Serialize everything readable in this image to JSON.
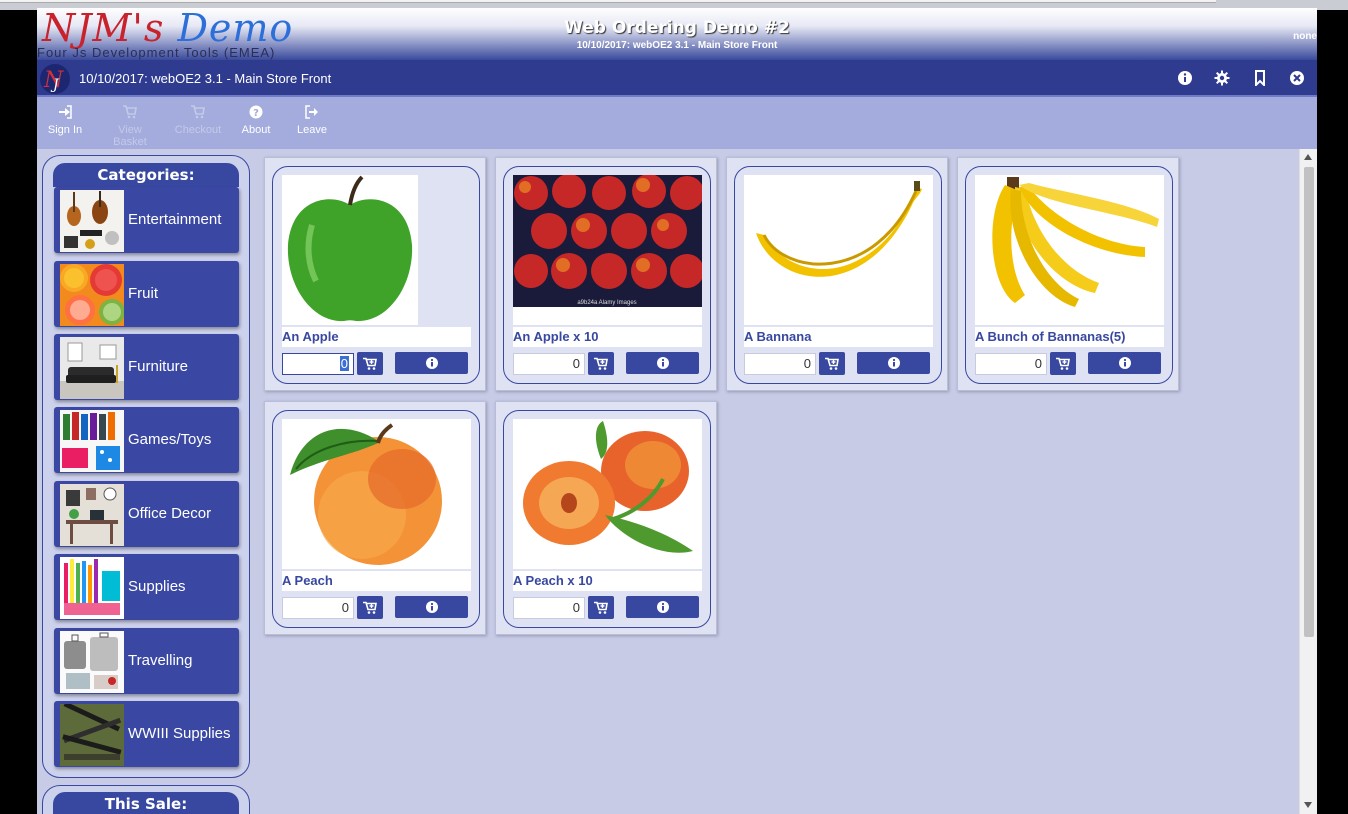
{
  "header": {
    "logo_part1": "NJM's",
    "logo_part2": "Demo",
    "logo_subtitle": "Four Js Development Tools (EMEA)",
    "title": "Web Ordering Demo #2",
    "subtitle": "10/10/2017: webOE2 3.1 - Main Store Front",
    "user": "none"
  },
  "titlebar": {
    "title": "10/10/2017: webOE2 3.1 - Main Store Front",
    "icons": [
      "info-icon",
      "gear-icon",
      "bookmark-icon",
      "close-icon"
    ]
  },
  "toolbar": {
    "items": [
      {
        "label": "Sign In",
        "icon": "sign-in-icon",
        "enabled": true
      },
      {
        "label": "View Basket",
        "icon": "cart-icon",
        "enabled": false
      },
      {
        "label": "Checkout",
        "icon": "cart-icon",
        "enabled": false
      },
      {
        "label": "About",
        "icon": "question-icon",
        "enabled": true
      },
      {
        "label": "Leave",
        "icon": "sign-out-icon",
        "enabled": true
      }
    ]
  },
  "categories": {
    "header": "Categories:",
    "items": [
      {
        "label": "Entertainment",
        "icon": "instruments-image"
      },
      {
        "label": "Fruit",
        "icon": "citrus-image"
      },
      {
        "label": "Furniture",
        "icon": "sofa-image"
      },
      {
        "label": "Games/Toys",
        "icon": "action-figures-image"
      },
      {
        "label": "Office Decor",
        "icon": "office-image"
      },
      {
        "label": "Supplies",
        "icon": "stationery-image"
      },
      {
        "label": "Travelling",
        "icon": "luggage-image"
      },
      {
        "label": "WWIII Supplies",
        "icon": "rifles-image"
      }
    ]
  },
  "sale": {
    "header": "This Sale:"
  },
  "products": [
    {
      "name": "An Apple",
      "qty": "0",
      "image": "green-apple-image"
    },
    {
      "name": "An Apple x 10",
      "qty": "0",
      "image": "red-apples-image"
    },
    {
      "name": "A Bannana",
      "qty": "0",
      "image": "banana-image"
    },
    {
      "name": "A Bunch of Bannanas(5)",
      "qty": "0",
      "image": "banana-bunch-image"
    },
    {
      "name": "A Peach",
      "qty": "0",
      "image": "peach-image"
    },
    {
      "name": "A Peach x 10",
      "qty": "0",
      "image": "peaches-image"
    }
  ],
  "apple_image_caption": "a9b24a  Alamy Images",
  "colors": {
    "accent": "#3848a0",
    "background": "#c7cbe6",
    "toolbar": "#a3acdc",
    "titlebar": "#2f3b8f"
  }
}
